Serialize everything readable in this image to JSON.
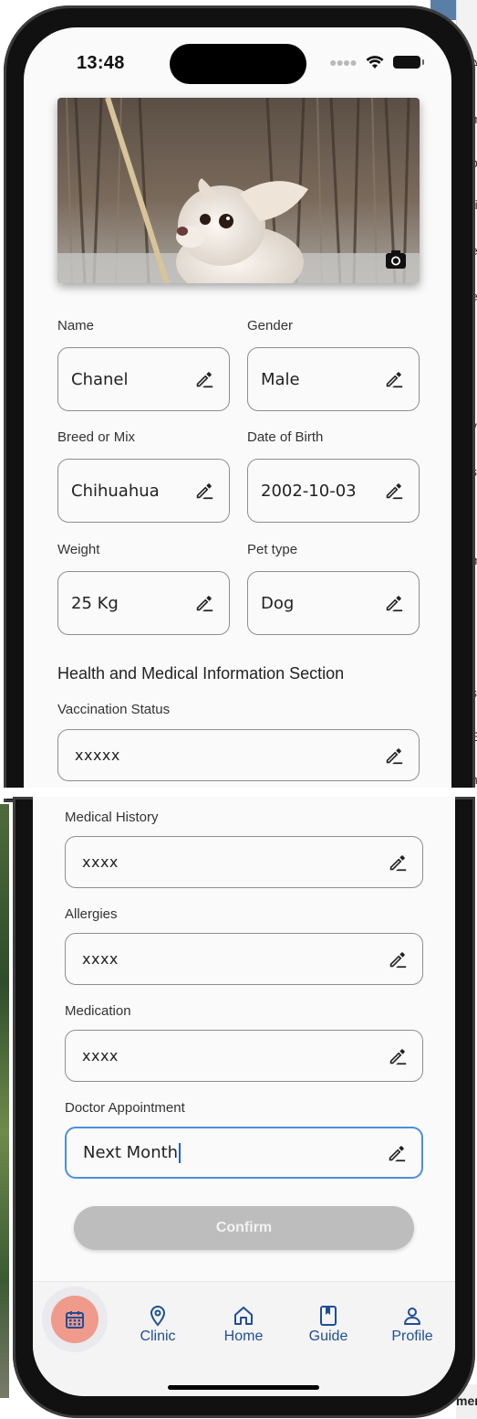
{
  "status_bar": {
    "time": "13:48"
  },
  "pet": {
    "photo_alt": "White Chihuahua dog",
    "name": {
      "label": "Name",
      "value": "Chanel"
    },
    "gender": {
      "label": "Gender",
      "value": "Male"
    },
    "breed": {
      "label": "Breed or Mix",
      "value": "Chihuahua"
    },
    "dob": {
      "label": "Date of Birth",
      "value": "2002-10-03"
    },
    "weight": {
      "label": "Weight",
      "value": "25 Kg"
    },
    "pet_type": {
      "label": "Pet type",
      "value": "Dog"
    }
  },
  "health": {
    "section_title": "Health and Medical Information Section",
    "vaccination": {
      "label": "Vaccination Status",
      "value": "xxxxx"
    },
    "medical_history": {
      "label": "Medical History",
      "value": "xxxx"
    },
    "allergies": {
      "label": "Allergies",
      "value": "xxxx"
    },
    "medication": {
      "label": "Medication",
      "value": "xxxx"
    },
    "doctor_appointment": {
      "label": "Doctor Appointment",
      "value": "Next Month"
    }
  },
  "confirm_label": "Confirm",
  "nav": {
    "fab_icon": "calendar-icon",
    "items": [
      {
        "label": "Clinic",
        "icon": "location-pin-icon"
      },
      {
        "label": "Home",
        "icon": "home-icon"
      },
      {
        "label": "Guide",
        "icon": "book-icon"
      },
      {
        "label": "Profile",
        "icon": "person-icon"
      }
    ]
  },
  "colors": {
    "accent_nav": "#1f4e96",
    "fab": "#ef9a8a",
    "active_border": "#4a90d9",
    "button_disabled": "#bdbdbd"
  },
  "background_fragments": [
    "As",
    "m",
    "p",
    "ri",
    "e",
    "e",
    "i",
    "i",
    "y",
    "s",
    "m",
    "s",
    "E",
    "n",
    "mer"
  ]
}
